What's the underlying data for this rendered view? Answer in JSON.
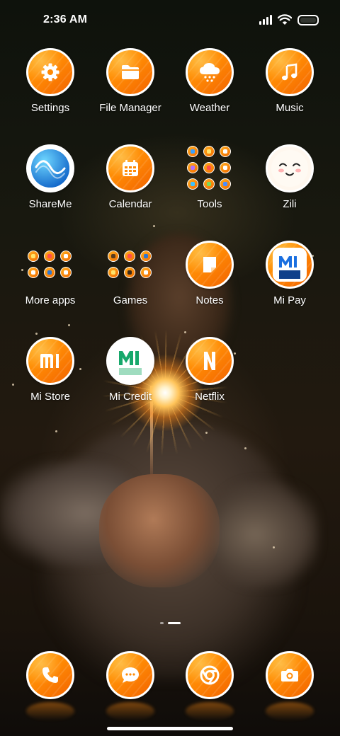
{
  "status_bar": {
    "time": "2:36 AM"
  },
  "apps": [
    {
      "label": "Settings",
      "icon": "gear-icon"
    },
    {
      "label": "File Manager",
      "icon": "folder-icon"
    },
    {
      "label": "Weather",
      "icon": "cloud-snow-icon"
    },
    {
      "label": "Music",
      "icon": "music-note-icon"
    },
    {
      "label": "ShareMe",
      "icon": "shareme-icon"
    },
    {
      "label": "Calendar",
      "icon": "calendar-icon"
    },
    {
      "label": "Tools",
      "icon": "folder-grid-icon"
    },
    {
      "label": "Zili",
      "icon": "zili-face-icon"
    },
    {
      "label": "More apps",
      "icon": "folder-grid-icon"
    },
    {
      "label": "Games",
      "icon": "folder-grid-icon"
    },
    {
      "label": "Notes",
      "icon": "note-icon"
    },
    {
      "label": "Mi Pay",
      "icon": "mi-pay-icon"
    },
    {
      "label": "Mi Store",
      "icon": "mi-logo-icon"
    },
    {
      "label": "Mi Credit",
      "icon": "mi-credit-icon"
    },
    {
      "label": "Netflix",
      "icon": "netflix-icon"
    }
  ],
  "dock": [
    {
      "icon": "phone-icon"
    },
    {
      "icon": "message-icon"
    },
    {
      "icon": "chrome-icon"
    },
    {
      "icon": "camera-icon"
    }
  ],
  "pager": {
    "pages": 2,
    "active": 2
  },
  "colors": {
    "icon_orange": "#ff8a05",
    "icon_orange_dark": "#f26300",
    "icon_border": "#ffffff"
  }
}
